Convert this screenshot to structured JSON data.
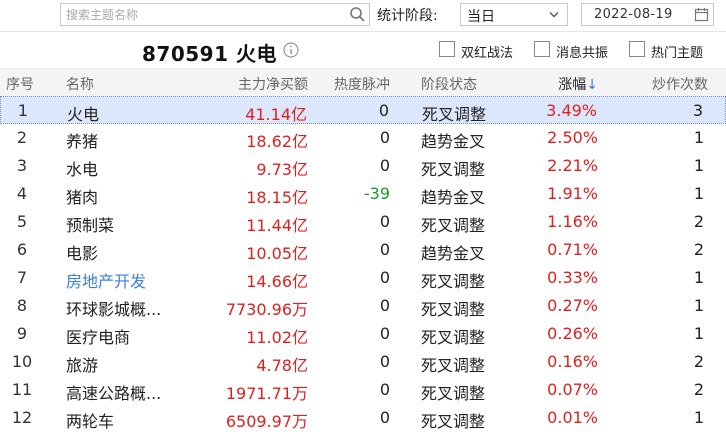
{
  "toolbar": {
    "search_placeholder": "搜索主题名称",
    "stage_label": "统计阶段:",
    "stage_value": "当日",
    "date_value": "2022-08-19"
  },
  "title": {
    "code_name": "870591 火电",
    "checkboxes": [
      {
        "label": "双红战法",
        "checked": false
      },
      {
        "label": "消息共振",
        "checked": false
      },
      {
        "label": "热门主题",
        "checked": false
      }
    ]
  },
  "table": {
    "headers": {
      "idx": "序号",
      "name": "名称",
      "amount": "主力净买额",
      "heat": "热度脉冲",
      "stage": "阶段状态",
      "pct": "涨幅",
      "pct_sort": "↓",
      "count": "炒作次数"
    },
    "rows": [
      {
        "idx": "1",
        "name": "火电",
        "amount": "41.14亿",
        "heat": "0",
        "stage": "死叉调整",
        "pct": "3.49%",
        "count": "3"
      },
      {
        "idx": "2",
        "name": "养猪",
        "amount": "18.62亿",
        "heat": "0",
        "stage": "趋势金叉",
        "pct": "2.50%",
        "count": "1"
      },
      {
        "idx": "3",
        "name": "水电",
        "amount": "9.73亿",
        "heat": "0",
        "stage": "死叉调整",
        "pct": "2.21%",
        "count": "1"
      },
      {
        "idx": "4",
        "name": "猪肉",
        "amount": "18.15亿",
        "heat": "-39",
        "stage": "趋势金叉",
        "pct": "1.91%",
        "count": "1"
      },
      {
        "idx": "5",
        "name": "预制菜",
        "amount": "11.44亿",
        "heat": "0",
        "stage": "死叉调整",
        "pct": "1.16%",
        "count": "2"
      },
      {
        "idx": "6",
        "name": "电影",
        "amount": "10.05亿",
        "heat": "0",
        "stage": "趋势金叉",
        "pct": "0.71%",
        "count": "2"
      },
      {
        "idx": "7",
        "name": "房地产开发",
        "amount": "14.66亿",
        "heat": "0",
        "stage": "死叉调整",
        "pct": "0.33%",
        "count": "1"
      },
      {
        "idx": "8",
        "name": "环球影城概...",
        "amount": "7730.96万",
        "heat": "0",
        "stage": "死叉调整",
        "pct": "0.27%",
        "count": "1"
      },
      {
        "idx": "9",
        "name": "医疗电商",
        "amount": "11.02亿",
        "heat": "0",
        "stage": "死叉调整",
        "pct": "0.26%",
        "count": "1"
      },
      {
        "idx": "10",
        "name": "旅游",
        "amount": "4.78亿",
        "heat": "0",
        "stage": "死叉调整",
        "pct": "0.16%",
        "count": "2"
      },
      {
        "idx": "11",
        "name": "高速公路概...",
        "amount": "1971.71万",
        "heat": "0",
        "stage": "死叉调整",
        "pct": "0.07%",
        "count": "2"
      },
      {
        "idx": "12",
        "name": "两轮车",
        "amount": "6509.97万",
        "heat": "0",
        "stage": "死叉调整",
        "pct": "0.01%",
        "count": "1"
      }
    ]
  },
  "colors": {
    "up": "#e02020",
    "down": "#1b9a2c",
    "link": "#3b7fe0",
    "selected_row": "#dde7fb"
  }
}
